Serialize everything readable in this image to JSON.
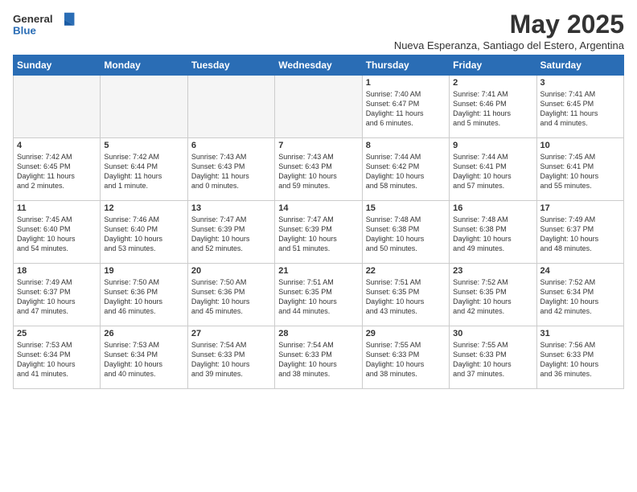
{
  "header": {
    "logo_general": "General",
    "logo_blue": "Blue",
    "month_title": "May 2025",
    "subtitle": "Nueva Esperanza, Santiago del Estero, Argentina"
  },
  "days_of_week": [
    "Sunday",
    "Monday",
    "Tuesday",
    "Wednesday",
    "Thursday",
    "Friday",
    "Saturday"
  ],
  "weeks": [
    [
      {
        "day": "",
        "info": ""
      },
      {
        "day": "",
        "info": ""
      },
      {
        "day": "",
        "info": ""
      },
      {
        "day": "",
        "info": ""
      },
      {
        "day": "1",
        "info": "Sunrise: 7:40 AM\nSunset: 6:47 PM\nDaylight: 11 hours\nand 6 minutes."
      },
      {
        "day": "2",
        "info": "Sunrise: 7:41 AM\nSunset: 6:46 PM\nDaylight: 11 hours\nand 5 minutes."
      },
      {
        "day": "3",
        "info": "Sunrise: 7:41 AM\nSunset: 6:45 PM\nDaylight: 11 hours\nand 4 minutes."
      }
    ],
    [
      {
        "day": "4",
        "info": "Sunrise: 7:42 AM\nSunset: 6:45 PM\nDaylight: 11 hours\nand 2 minutes."
      },
      {
        "day": "5",
        "info": "Sunrise: 7:42 AM\nSunset: 6:44 PM\nDaylight: 11 hours\nand 1 minute."
      },
      {
        "day": "6",
        "info": "Sunrise: 7:43 AM\nSunset: 6:43 PM\nDaylight: 11 hours\nand 0 minutes."
      },
      {
        "day": "7",
        "info": "Sunrise: 7:43 AM\nSunset: 6:43 PM\nDaylight: 10 hours\nand 59 minutes."
      },
      {
        "day": "8",
        "info": "Sunrise: 7:44 AM\nSunset: 6:42 PM\nDaylight: 10 hours\nand 58 minutes."
      },
      {
        "day": "9",
        "info": "Sunrise: 7:44 AM\nSunset: 6:41 PM\nDaylight: 10 hours\nand 57 minutes."
      },
      {
        "day": "10",
        "info": "Sunrise: 7:45 AM\nSunset: 6:41 PM\nDaylight: 10 hours\nand 55 minutes."
      }
    ],
    [
      {
        "day": "11",
        "info": "Sunrise: 7:45 AM\nSunset: 6:40 PM\nDaylight: 10 hours\nand 54 minutes."
      },
      {
        "day": "12",
        "info": "Sunrise: 7:46 AM\nSunset: 6:40 PM\nDaylight: 10 hours\nand 53 minutes."
      },
      {
        "day": "13",
        "info": "Sunrise: 7:47 AM\nSunset: 6:39 PM\nDaylight: 10 hours\nand 52 minutes."
      },
      {
        "day": "14",
        "info": "Sunrise: 7:47 AM\nSunset: 6:39 PM\nDaylight: 10 hours\nand 51 minutes."
      },
      {
        "day": "15",
        "info": "Sunrise: 7:48 AM\nSunset: 6:38 PM\nDaylight: 10 hours\nand 50 minutes."
      },
      {
        "day": "16",
        "info": "Sunrise: 7:48 AM\nSunset: 6:38 PM\nDaylight: 10 hours\nand 49 minutes."
      },
      {
        "day": "17",
        "info": "Sunrise: 7:49 AM\nSunset: 6:37 PM\nDaylight: 10 hours\nand 48 minutes."
      }
    ],
    [
      {
        "day": "18",
        "info": "Sunrise: 7:49 AM\nSunset: 6:37 PM\nDaylight: 10 hours\nand 47 minutes."
      },
      {
        "day": "19",
        "info": "Sunrise: 7:50 AM\nSunset: 6:36 PM\nDaylight: 10 hours\nand 46 minutes."
      },
      {
        "day": "20",
        "info": "Sunrise: 7:50 AM\nSunset: 6:36 PM\nDaylight: 10 hours\nand 45 minutes."
      },
      {
        "day": "21",
        "info": "Sunrise: 7:51 AM\nSunset: 6:35 PM\nDaylight: 10 hours\nand 44 minutes."
      },
      {
        "day": "22",
        "info": "Sunrise: 7:51 AM\nSunset: 6:35 PM\nDaylight: 10 hours\nand 43 minutes."
      },
      {
        "day": "23",
        "info": "Sunrise: 7:52 AM\nSunset: 6:35 PM\nDaylight: 10 hours\nand 42 minutes."
      },
      {
        "day": "24",
        "info": "Sunrise: 7:52 AM\nSunset: 6:34 PM\nDaylight: 10 hours\nand 42 minutes."
      }
    ],
    [
      {
        "day": "25",
        "info": "Sunrise: 7:53 AM\nSunset: 6:34 PM\nDaylight: 10 hours\nand 41 minutes."
      },
      {
        "day": "26",
        "info": "Sunrise: 7:53 AM\nSunset: 6:34 PM\nDaylight: 10 hours\nand 40 minutes."
      },
      {
        "day": "27",
        "info": "Sunrise: 7:54 AM\nSunset: 6:33 PM\nDaylight: 10 hours\nand 39 minutes."
      },
      {
        "day": "28",
        "info": "Sunrise: 7:54 AM\nSunset: 6:33 PM\nDaylight: 10 hours\nand 38 minutes."
      },
      {
        "day": "29",
        "info": "Sunrise: 7:55 AM\nSunset: 6:33 PM\nDaylight: 10 hours\nand 38 minutes."
      },
      {
        "day": "30",
        "info": "Sunrise: 7:55 AM\nSunset: 6:33 PM\nDaylight: 10 hours\nand 37 minutes."
      },
      {
        "day": "31",
        "info": "Sunrise: 7:56 AM\nSunset: 6:33 PM\nDaylight: 10 hours\nand 36 minutes."
      }
    ]
  ]
}
